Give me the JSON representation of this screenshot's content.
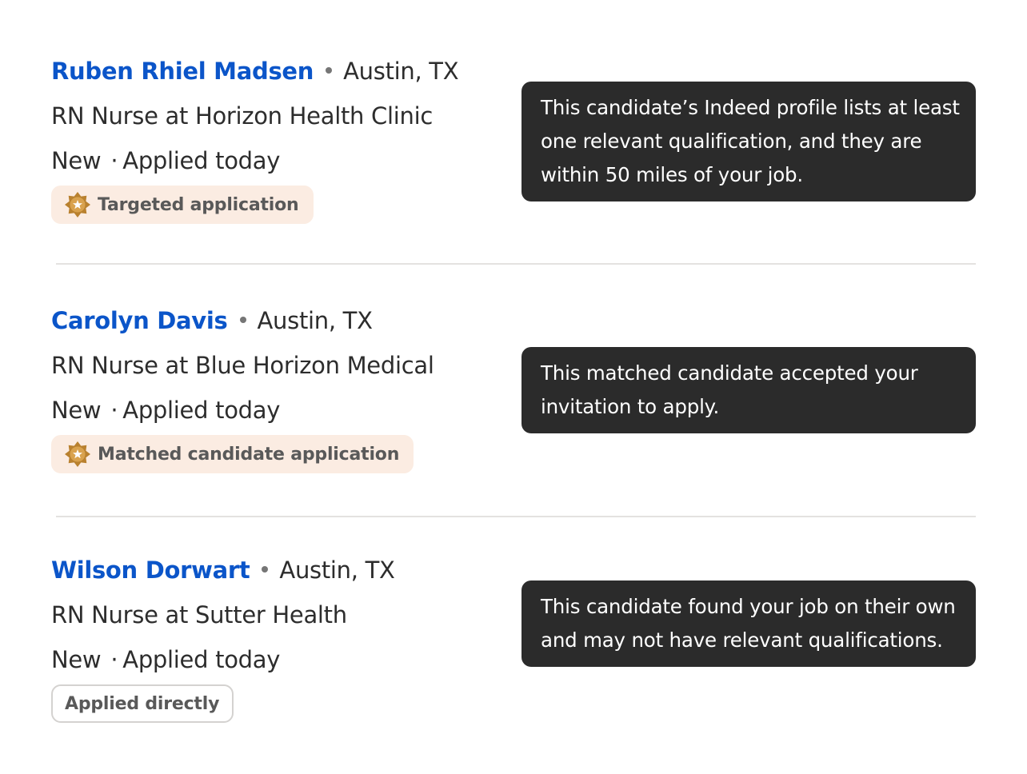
{
  "candidates": [
    {
      "name": "Ruben Rhiel Madsen",
      "location": "Austin, TX",
      "job": "RN Nurse at Horizon Health Clinic",
      "status": "New",
      "applied": "Applied today",
      "badge": {
        "label": "Targeted application",
        "style": "warm",
        "icon": "star-seal-icon"
      },
      "tooltip": "This candidate’s Indeed profile lists at least one relevant qualification, and they are within 50 miles of your job."
    },
    {
      "name": "Carolyn Davis",
      "location": "Austin, TX",
      "job": "RN Nurse at Blue Horizon Medical",
      "status": "New",
      "applied": "Applied today",
      "badge": {
        "label": "Matched candidate application",
        "style": "warm",
        "icon": "star-seal-icon"
      },
      "tooltip": "This matched candidate accepted your invitation to apply."
    },
    {
      "name": "Wilson Dorwart",
      "location": "Austin, TX",
      "job": "RN Nurse at Sutter Health",
      "status": "New",
      "applied": "Applied today",
      "badge": {
        "label": "Applied directly",
        "style": "plain",
        "icon": ""
      },
      "tooltip": "This candidate found your job on their own and may not have relevant qualifications."
    }
  ],
  "separator": "·",
  "colors": {
    "name_link": "#0b55c9",
    "tooltip_bg": "#2b2b2b",
    "badge_warm_bg": "#fbece2",
    "badge_icon": "#b9812f",
    "divider": "#e4e2e0"
  }
}
